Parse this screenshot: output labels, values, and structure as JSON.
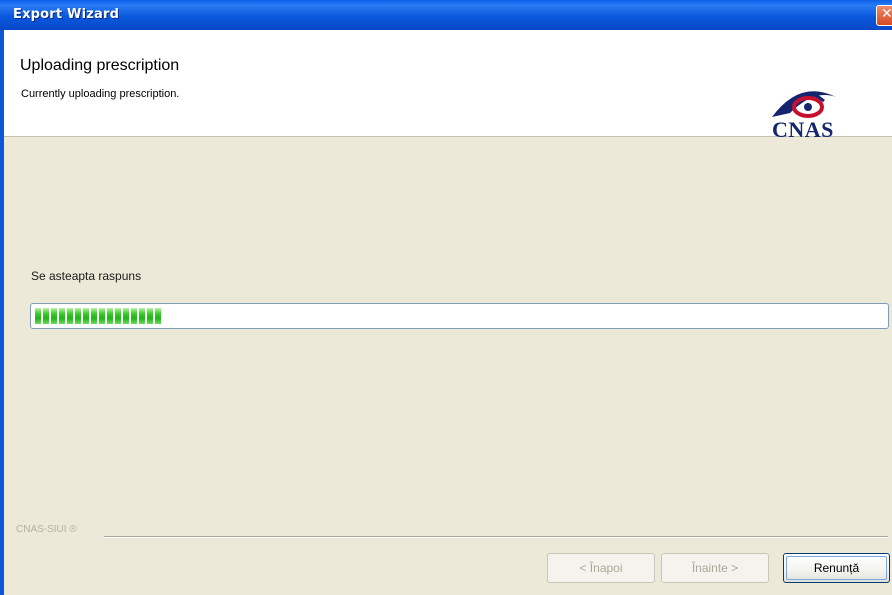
{
  "window": {
    "title": "Export Wizard",
    "close_glyph": "✕"
  },
  "header": {
    "heading": "Uploading prescription",
    "subheading": "Currently uploading prescription.",
    "logo_text": "CNAS"
  },
  "main": {
    "status_label": "Se asteapta raspuns",
    "progress_fraction": 0.15
  },
  "footer": {
    "brand": "CNAS-SIUI ®",
    "back_label": "< Înapoi",
    "next_label": "Înainte >",
    "cancel_label": "Renunță"
  },
  "colors": {
    "titlebar": "#0b58de",
    "progress_green": "#22b21a",
    "logo_blue": "#15256e",
    "logo_red": "#c8102e"
  }
}
